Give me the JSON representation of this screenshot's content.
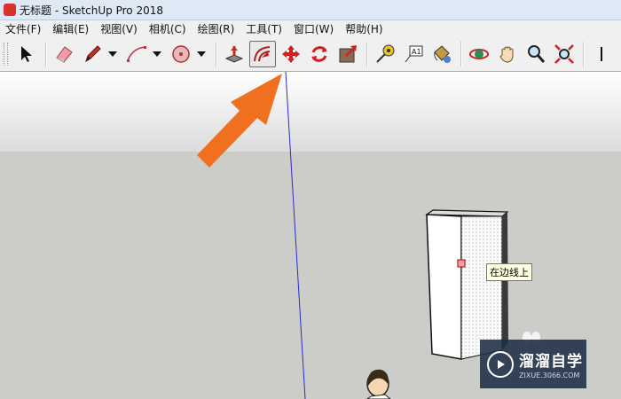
{
  "window": {
    "title": "无标题 - SketchUp Pro 2018"
  },
  "menu": [
    "文件(F)",
    "编辑(E)",
    "视图(V)",
    "相机(C)",
    "绘图(R)",
    "工具(T)",
    "窗口(W)",
    "帮助(H)"
  ],
  "toolbar": {
    "tools": [
      "select-tool",
      "eraser-tool",
      "pencil-line-tool",
      "arc-tool",
      "shapes-tool",
      "push-pull-tool",
      "offset-tool",
      "move-tool",
      "rotate-tool",
      "scale-tool",
      "tape-measure-tool",
      "text-tool",
      "paint-bucket-tool",
      "orbit-tool",
      "pan-tool",
      "zoom-tool",
      "zoom-extents-tool"
    ],
    "active_tool": "offset-tool"
  },
  "canvas": {
    "tooltip": "在边线上",
    "colors": {
      "sky": "#ffffff",
      "ground": "#ccccc8",
      "blue_axis": "#2b2bd6",
      "arrow": "#f07020"
    }
  },
  "watermark": {
    "title": "溜溜自学",
    "url": "ZIXUE.3066.COM"
  }
}
